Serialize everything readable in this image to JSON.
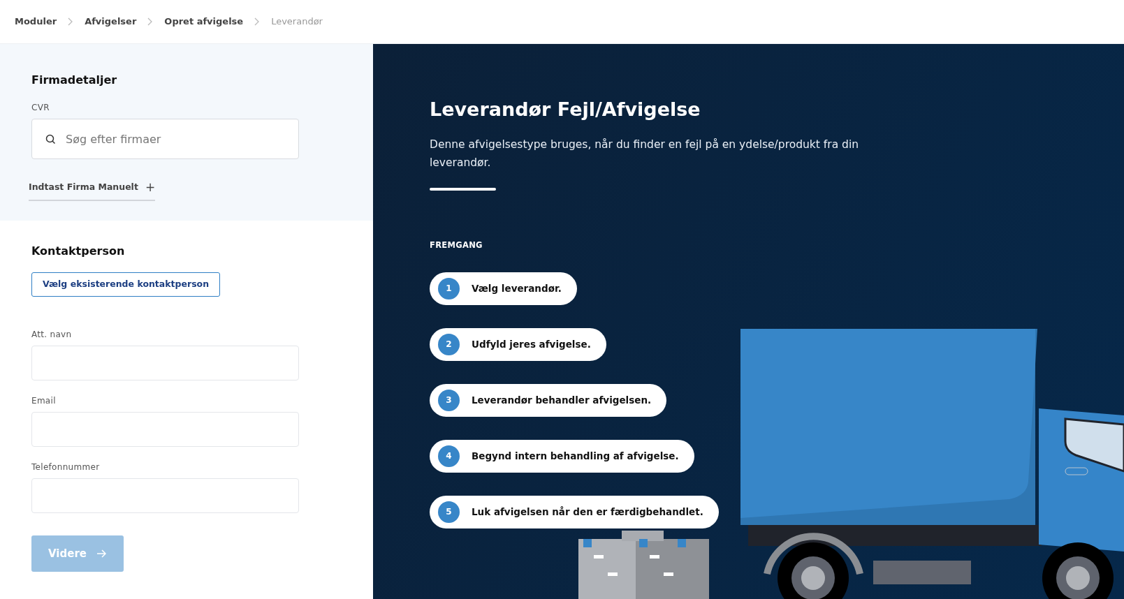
{
  "breadcrumb": [
    {
      "label": "Moduler",
      "current": false
    },
    {
      "label": "Afvigelser",
      "current": false
    },
    {
      "label": "Opret afvigelse",
      "current": false
    },
    {
      "label": "Leverandør",
      "current": true
    }
  ],
  "company": {
    "title": "Firmadetaljer",
    "cvr_label": "CVR",
    "search_placeholder": "Søg efter firmaer",
    "manual_link": "Indtast Firma Manuelt",
    "manual_icon": "+"
  },
  "contact": {
    "title": "Kontaktperson",
    "choose_button": "Vælg eksisterende kontaktperson",
    "fields": [
      {
        "label": "Att. navn"
      },
      {
        "label": "Email"
      },
      {
        "label": "Telefonnummer"
      }
    ]
  },
  "next_button": {
    "label": "Videre",
    "disabled": true
  },
  "hero": {
    "title": "Leverandør Fejl/Afvigelse",
    "description": "Denne afvigelsestype bruges, når du finder en fejl på en ydelse/produkt fra din leverandør.",
    "progress_heading": "FREMGANG",
    "steps": [
      {
        "number": "1",
        "label": "Vælg leverandør."
      },
      {
        "number": "2",
        "label": "Udfyld jeres afvigelse."
      },
      {
        "number": "3",
        "label": "Leverandør behandler afvigelsen."
      },
      {
        "number": "4",
        "label": "Begynd intern behandling af afvigelse."
      },
      {
        "number": "5",
        "label": "Luk afvigelsen når den er færdigbehandlet."
      }
    ]
  }
}
